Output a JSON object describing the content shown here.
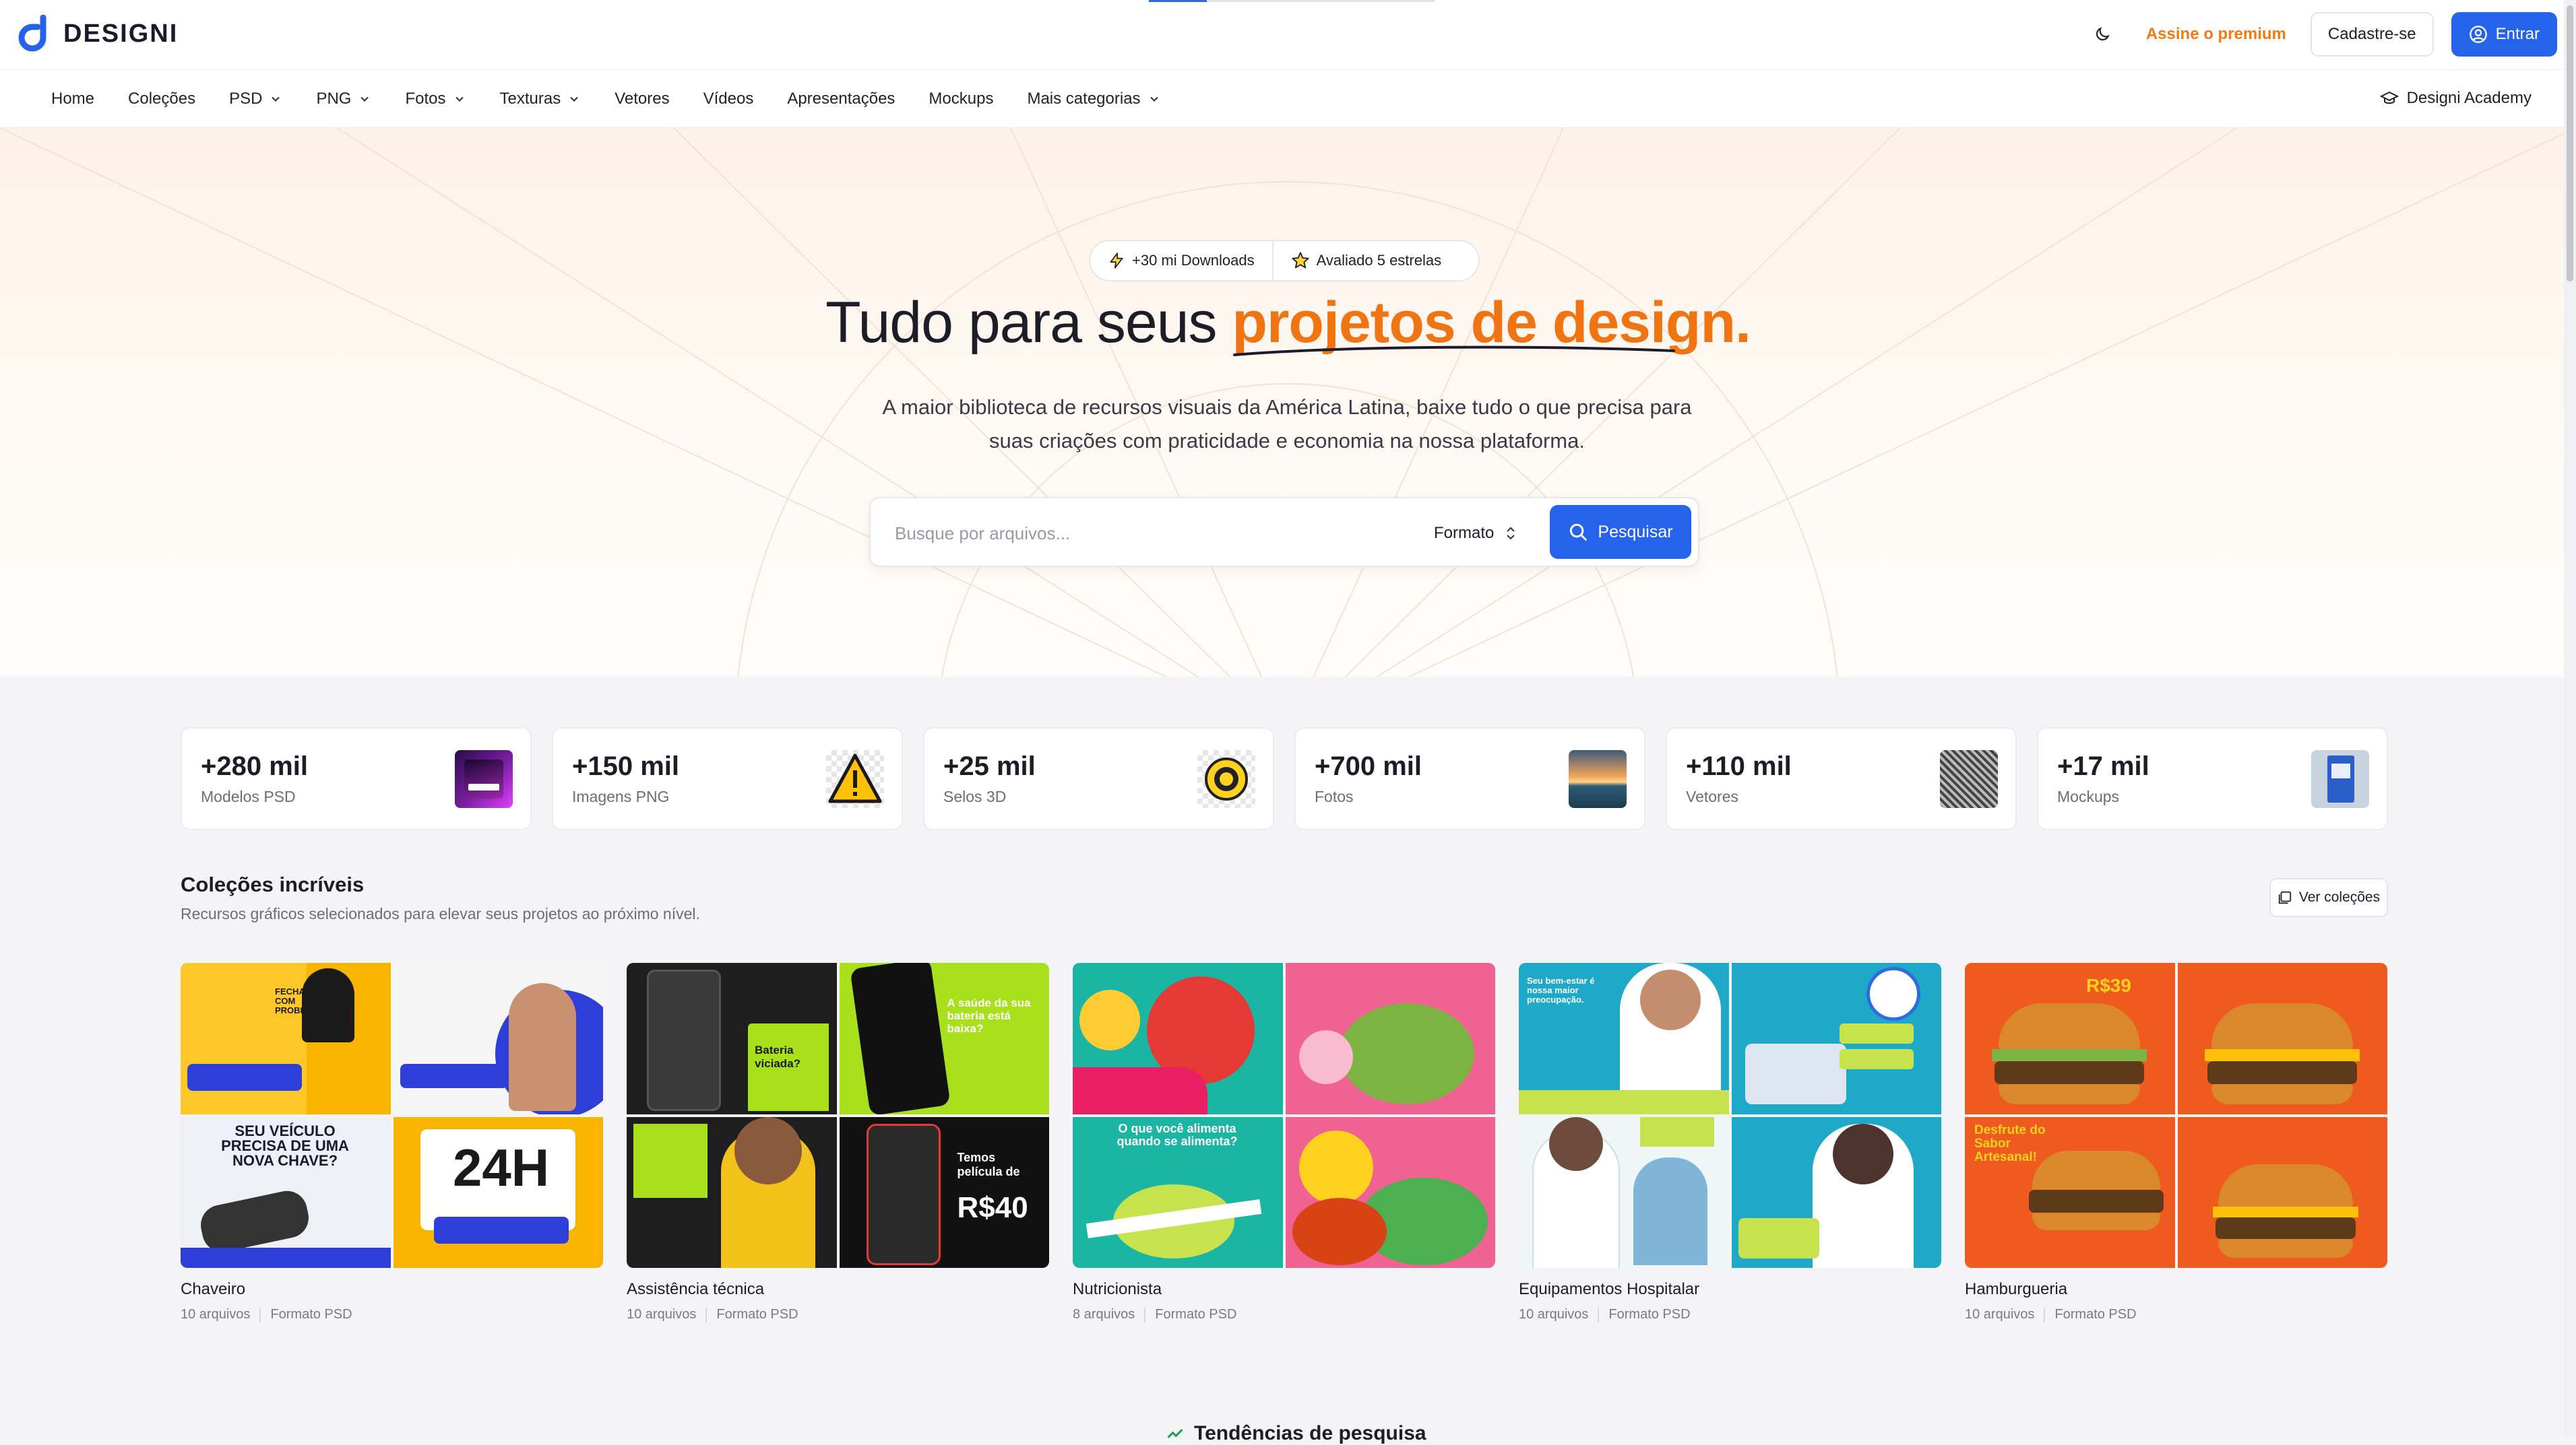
{
  "brand": {
    "name": "DESIGNI"
  },
  "header": {
    "premium_label": "Assine o premium",
    "signup_label": "Cadastre-se",
    "login_label": "Entrar"
  },
  "nav": {
    "items": [
      {
        "label": "Home",
        "dropdown": false
      },
      {
        "label": "Coleções",
        "dropdown": false
      },
      {
        "label": "PSD",
        "dropdown": true
      },
      {
        "label": "PNG",
        "dropdown": true
      },
      {
        "label": "Fotos",
        "dropdown": true
      },
      {
        "label": "Texturas",
        "dropdown": true
      },
      {
        "label": "Vetores",
        "dropdown": false
      },
      {
        "label": "Vídeos",
        "dropdown": false
      },
      {
        "label": "Apresentações",
        "dropdown": false
      },
      {
        "label": "Mockups",
        "dropdown": false
      },
      {
        "label": "Mais categorias",
        "dropdown": true
      }
    ],
    "academy_label": "Designi Academy"
  },
  "hero": {
    "badge_downloads": "+30 mi Downloads",
    "badge_rating": "Avaliado 5 estrelas",
    "title_plain": "Tudo para seus ",
    "title_accent": "projetos de design.",
    "subtitle": "A maior biblioteca de recursos visuais da América Latina, baixe tudo o que precisa para suas criações com praticidade e economia na nossa plataforma.",
    "search_placeholder": "Busque por arquivos...",
    "format_label": "Formato",
    "search_button": "Pesquisar"
  },
  "stats": [
    {
      "value": "+280 mil",
      "label": "Modelos PSD"
    },
    {
      "value": "+150 mil",
      "label": "Imagens PNG"
    },
    {
      "value": "+25 mil",
      "label": "Selos 3D"
    },
    {
      "value": "+700 mil",
      "label": "Fotos"
    },
    {
      "value": "+110 mil",
      "label": "Vetores"
    },
    {
      "value": "+17 mil",
      "label": "Mockups"
    }
  ],
  "collections": {
    "title": "Coleções incríveis",
    "subtitle": "Recursos gráficos selecionados para elevar seus projetos ao próximo nível.",
    "view_all_label": "Ver coleções",
    "items": [
      {
        "name": "Chaveiro",
        "files": "10 arquivos",
        "format": "Formato PSD"
      },
      {
        "name": "Assistência técnica",
        "files": "10 arquivos",
        "format": "Formato PSD"
      },
      {
        "name": "Nutricionista",
        "files": "8 arquivos",
        "format": "Formato PSD"
      },
      {
        "name": "Equipamentos Hospitalar",
        "files": "10 arquivos",
        "format": "Formato PSD"
      },
      {
        "name": "Hamburgueria",
        "files": "10 arquivos",
        "format": "Formato PSD"
      }
    ],
    "tile_texts": {
      "chaveiro_1": "FECHADURA COM PROBLEMAS?",
      "chaveiro_3": "SEU VEÍCULO PRECISA DE UMA NOVA CHAVE?",
      "chaveiro_4": "24H",
      "assist_1": "Bateria viciada?",
      "assist_2": "A saúde da sua bateria está baixa?",
      "assist_4": "Temos película de",
      "assist_4_price": "R$40",
      "nutri_3": "O que você alimenta quando se alimenta?",
      "hosp_1": "Seu bem-estar é nossa maior preocupação.",
      "burger_1": "R$39",
      "burger_3": "Desfrute do Sabor Artesanal!"
    }
  },
  "trending": {
    "title": "Tendências de pesquisa"
  },
  "colors": {
    "accent": "#f07512",
    "primary": "#2563eb"
  }
}
